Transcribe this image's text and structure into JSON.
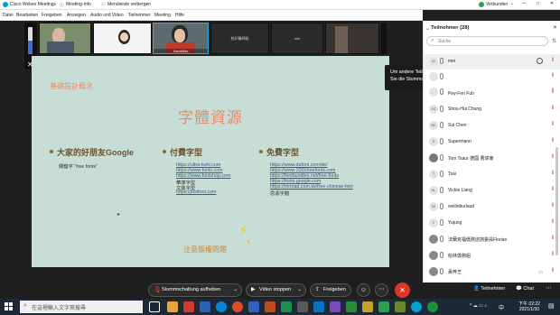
{
  "window": {
    "app_title": "Cisco Webex Meetings",
    "meeting_info": "Meeting-Info",
    "hide_menu": "Menüleiste verbergen",
    "connected": "Verbunden"
  },
  "menu": [
    "Datei",
    "Bearbeiten",
    "Freigeben",
    "Anzeigen",
    "Audio und Video",
    "Teilnehmer",
    "Meeting",
    "Hilfe"
  ],
  "thumbnails": [
    {
      "label": ""
    },
    {
      "label": ""
    },
    {
      "label": "XiaoNiNe"
    },
    {
      "label": "柏好醫師組"
    },
    {
      "label": "mei"
    },
    {
      "label": ""
    }
  ],
  "slide": {
    "top_label": "基礎設計概念",
    "title": "字體資源",
    "col1_title": "大家的好朋友Google",
    "col1_sub": "關鍵字 “free fonts”",
    "col2_title": "付費字型",
    "col2_links": [
      "https://ultra-kuhl.com",
      "https://www.fonts.com",
      "https://www.fontshop.com",
      "華康字型",
      "文鼎字型",
      "https://justfont.com"
    ],
    "col3_title": "免費字型",
    "col3_links": [
      "https://www.dafont.com/de/",
      "https://www.1001freefonts.com",
      "https://fontbundles.net/free-fonts",
      "https://fonts.google.com",
      "https://mrmad.com.tw/free-chinese-font",
      "思源字體"
    ],
    "note": "注意版權問題",
    "accent_color": "#e98a6a"
  },
  "tooltip": {
    "text": "Um andere Teilnehmer zu hören, deaktivieren Sie die Stummschaltung."
  },
  "panel": {
    "title": "Teilnehmer (28)",
    "search_placeholder": "Suche",
    "participants": [
      {
        "initials": "M",
        "name": "mei"
      },
      {
        "initials": "",
        "name": ""
      },
      {
        "initials": "",
        "name": ""
      },
      {
        "initials": "",
        "name": "Pey-Fen Fuh"
      },
      {
        "initials": "SC",
        "name": "Shou-Hui Chung"
      },
      {
        "initials": "SC",
        "name": "Sui Chen"
      },
      {
        "initials": "S",
        "name": "Supermann"
      },
      {
        "initials": "",
        "name": "Toni Tsaur 德國 曹瑋東"
      },
      {
        "initials": "T",
        "name": "Tsai"
      },
      {
        "initials": "VL",
        "name": "Vickie Liang"
      },
      {
        "initials": "W",
        "name": "weilinburlaud"
      },
      {
        "initials": "Y",
        "name": "Yujung"
      },
      {
        "initials": "",
        "name": "法蘭克福僑務諮詢委員Florian"
      },
      {
        "initials": "",
        "name": "柏林僑務組"
      },
      {
        "initials": "",
        "name": "黃梓芝"
      }
    ]
  },
  "controls": {
    "mute": "Stummschaltung aufheben",
    "video": "Video stoppen",
    "share": "Freigeben",
    "participants": "Teilnehmer",
    "chat": "Chat"
  },
  "taskbar": {
    "search_placeholder": "在這裡輸入文字來搜尋",
    "time": "下午 02:22",
    "date": "2021/1/30",
    "lang": "中"
  }
}
